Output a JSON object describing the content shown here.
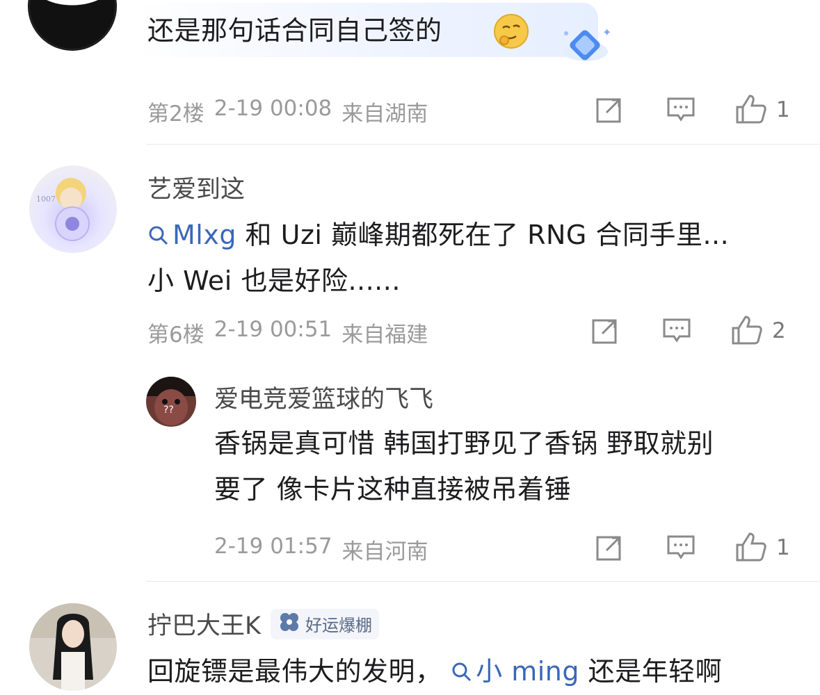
{
  "comments": [
    {
      "text": "还是那句话合同自己签的",
      "floor": "第2楼",
      "time": "2-19 00:08",
      "location": "来自湖南",
      "likes": "1"
    },
    {
      "username": "艺爱到这",
      "search_prefix_1": "Mlxg",
      "text_line1": "和 Uzi 巅峰期都死在了 RNG 合同手里...",
      "text_line2": "小 Wei 也是好险......",
      "floor": "第6楼",
      "time": "2-19 00:51",
      "location": "来自福建",
      "likes": "2",
      "reply": {
        "username": "爱电竞爱篮球的飞飞",
        "text_line1": "香锅是真可惜 韩国打野见了香锅 野取就别",
        "text_line2": "要了 像卡片这种直接被吊着锤",
        "time": "2-19 01:57",
        "location": "来自河南",
        "likes": "1"
      }
    },
    {
      "username": "拧巴大王K",
      "badge": "好运爆棚",
      "text_pre": "回旋镖是最伟大的发明，",
      "search_link": "小 ming",
      "text_post": "还是年轻啊"
    }
  ],
  "colors": {
    "link": "#3a67b8",
    "meta": "#9a9a9a",
    "divider": "#e8e8e8"
  },
  "icons": [
    "share-icon",
    "comment-icon",
    "like-icon",
    "search-icon",
    "diamond-sticker-icon",
    "thinking-emoji-icon",
    "clover-icon"
  ]
}
